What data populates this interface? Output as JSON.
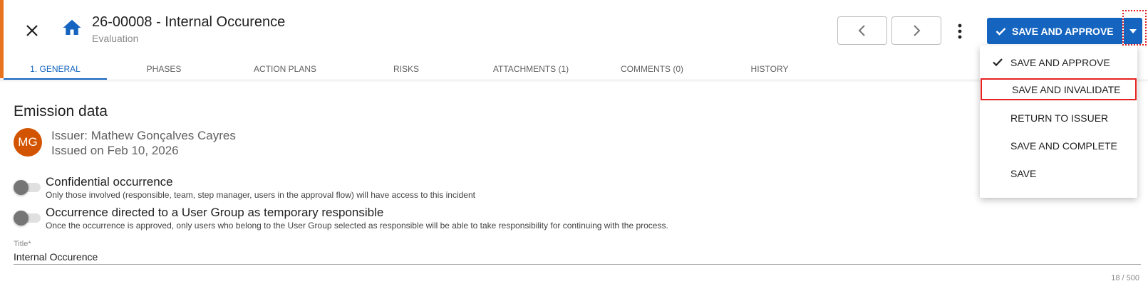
{
  "header": {
    "title": "26-00008 - Internal Occurence",
    "subtitle": "Evaluation",
    "save_button_label": "SAVE AND APPROVE"
  },
  "icons": {
    "close": "close-icon",
    "home": "home-icon",
    "prev": "chevron-left-icon",
    "next": "chevron-right-icon",
    "more": "more-vertical-icon",
    "check": "check-icon",
    "caret": "caret-down-icon"
  },
  "colors": {
    "accent": "#e8731f",
    "primary": "#1565c0",
    "avatar": "#d35400",
    "highlight": "#e52020"
  },
  "tabs": [
    {
      "label": "1. GENERAL",
      "active": true
    },
    {
      "label": "PHASES"
    },
    {
      "label": "ACTION PLANS"
    },
    {
      "label": "RISKS"
    },
    {
      "label": "ATTACHMENTS (1)"
    },
    {
      "label": "COMMENTS (0)"
    },
    {
      "label": "HISTORY"
    }
  ],
  "section": {
    "title": "Emission data",
    "avatar_initials": "MG",
    "issuer": "Issuer: Mathew Gonçalves Cayres",
    "issued_on": "Issued on Feb 10, 2026"
  },
  "toggles": [
    {
      "label": "Confidential occurrence",
      "description": "Only those involved (responsible, team, step manager, users in the approval flow) will have access to this incident",
      "on": false
    },
    {
      "label": "Occurrence directed to a User Group as temporary responsible",
      "description": "Once the occurrence is approved, only users who belong to the User Group selected as responsible will be able to take responsibility for continuing with the process.",
      "on": false
    }
  ],
  "title_field": {
    "label": "Title*",
    "value": "Internal Occurence",
    "counter": "18 / 500"
  },
  "dropdown": {
    "items": [
      {
        "label": "SAVE AND APPROVE",
        "checked": true
      },
      {
        "label": "SAVE AND INVALIDATE",
        "highlighted": true
      },
      {
        "label": "RETURN TO ISSUER"
      },
      {
        "label": "SAVE AND COMPLETE"
      },
      {
        "label": "SAVE"
      }
    ]
  }
}
